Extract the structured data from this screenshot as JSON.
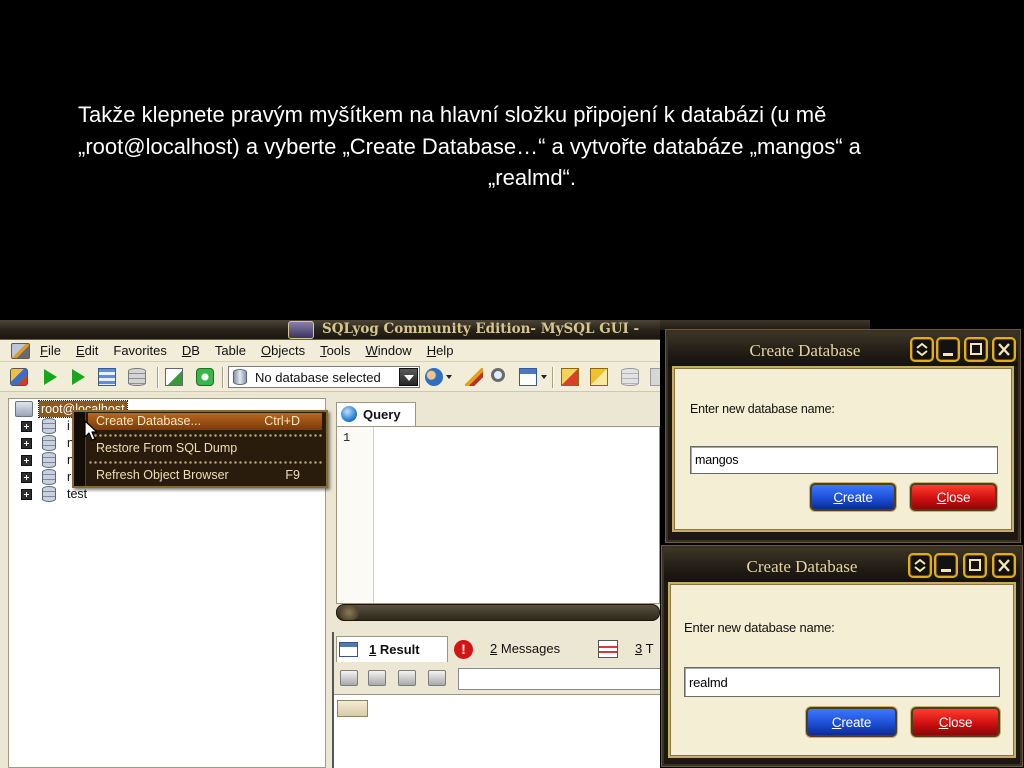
{
  "slide": {
    "lines": [
      "Takže klepnete pravým myšítkem na hlavní složku připojení k databázi (u mě",
      "„root@localhost) a vyberte „Create Database…“ a vytvořte databáze „mangos“ a",
      "„realmd“."
    ]
  },
  "colors": {
    "slide_background": "#000000",
    "slide_text": "#ffffff",
    "dialog_body": "#f4eed4",
    "create_button": "#1d4fd6",
    "close_button": "#d01010",
    "menu_highlight": "#9a5215"
  },
  "sqlyog": {
    "title": "SQLyog Community Edition- MySQL GUI -",
    "menu": [
      "File",
      "Edit",
      "Favorites",
      "DB",
      "Table",
      "Objects",
      "Tools",
      "Window",
      "Help"
    ],
    "toolbar": {
      "icons": [
        "connect-icon",
        "execute-query-icon",
        "execute-all-icon",
        "table-data-icon",
        "database-icon",
        "sql-file-icon",
        "refresh-icon",
        "user-manager-icon",
        "brush-icon",
        "search-icon",
        "table-icon",
        "export-icon",
        "import-icon",
        "database-tool-icon"
      ],
      "database_selector": "No database selected"
    },
    "object_browser": {
      "connection": "root@localhost",
      "databases": [
        "i",
        "n",
        "n",
        "r",
        "test"
      ]
    },
    "context_menu": [
      {
        "label": "Create Database...",
        "shortcut": "Ctrl+D",
        "highlighted": true
      },
      {
        "label": "Restore From SQL Dump",
        "shortcut": ""
      },
      {
        "label": "Refresh Object Browser",
        "shortcut": "F9"
      }
    ],
    "query": {
      "tab_label": "Query",
      "line_numbers": [
        "1"
      ]
    },
    "results": {
      "tabs": [
        {
          "number": "1",
          "label": "Result"
        },
        {
          "number": "2",
          "label": "Messages"
        },
        {
          "number": "3",
          "label": "T"
        }
      ]
    }
  },
  "dialogs": [
    {
      "title": "Create Database",
      "prompt": "Enter new database name:",
      "value": "mangos",
      "create_label": "Create",
      "close_label": "Close"
    },
    {
      "title": "Create Database",
      "prompt": "Enter new database name:",
      "value": "realmd",
      "create_label": "Create",
      "close_label": "Close"
    }
  ]
}
